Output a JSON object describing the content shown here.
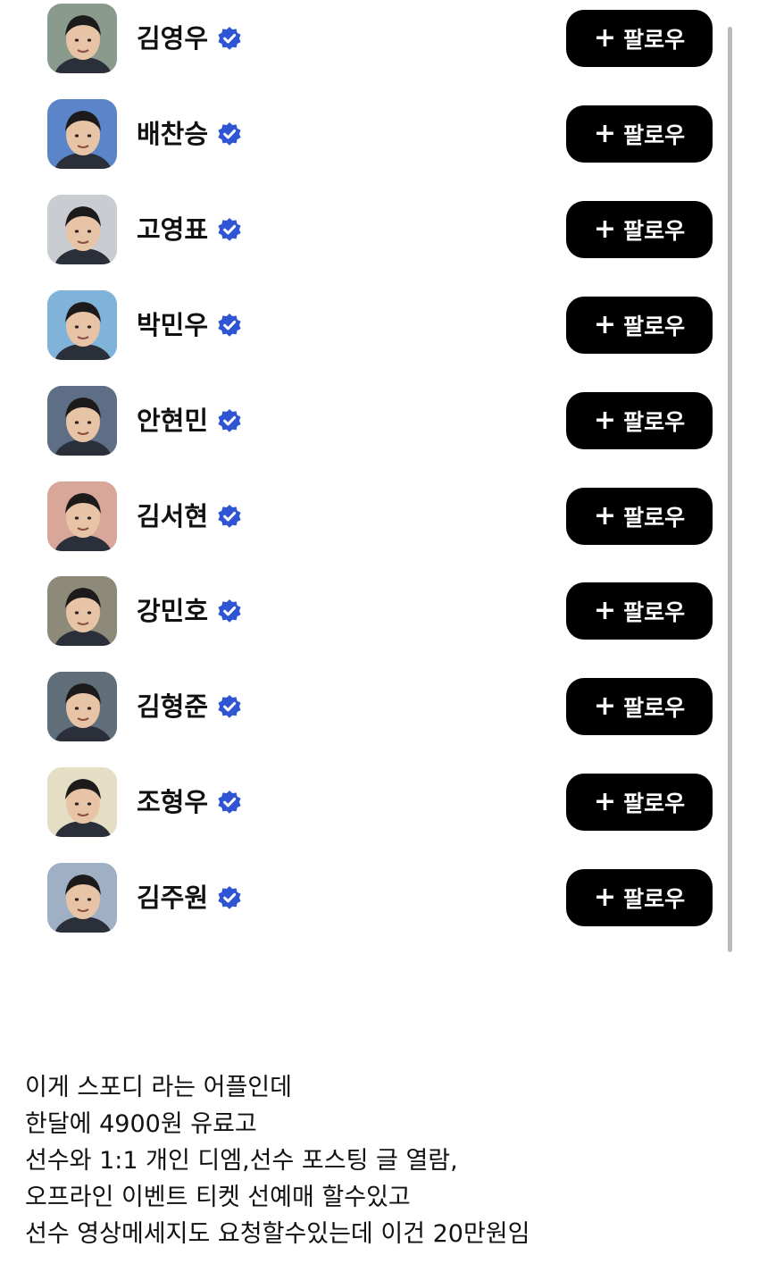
{
  "follow_label": "팔로우",
  "follow_icon": "plus-icon",
  "verified_icon": "verified-badge-icon",
  "colors": {
    "verified": "#2f55d4",
    "button_bg": "#000000",
    "button_text": "#ffffff"
  },
  "players": [
    {
      "name": "김영우",
      "avatar_bg": "#8a9a8c"
    },
    {
      "name": "배찬승",
      "avatar_bg": "#5b85c9"
    },
    {
      "name": "고영표",
      "avatar_bg": "#c9cdd2"
    },
    {
      "name": "박민우",
      "avatar_bg": "#7fb3d9"
    },
    {
      "name": "안현민",
      "avatar_bg": "#5d6e86"
    },
    {
      "name": "김서현",
      "avatar_bg": "#d9a79a"
    },
    {
      "name": "강민호",
      "avatar_bg": "#8d8a7a"
    },
    {
      "name": "김형준",
      "avatar_bg": "#5f6e78"
    },
    {
      "name": "조형우",
      "avatar_bg": "#e4dfc4"
    },
    {
      "name": "김주원",
      "avatar_bg": "#9fb0c5"
    }
  ],
  "post_lines": [
    "이게 스포디 라는 어플인데",
    "한달에 4900원 유료고",
    "선수와 1:1 개인 디엠,선수 포스팅 글 열람,",
    "오프라인 이벤트 티켓 선예매 할수있고",
    "선수 영상메세지도 요청할수있는데 이건 20만원임"
  ]
}
